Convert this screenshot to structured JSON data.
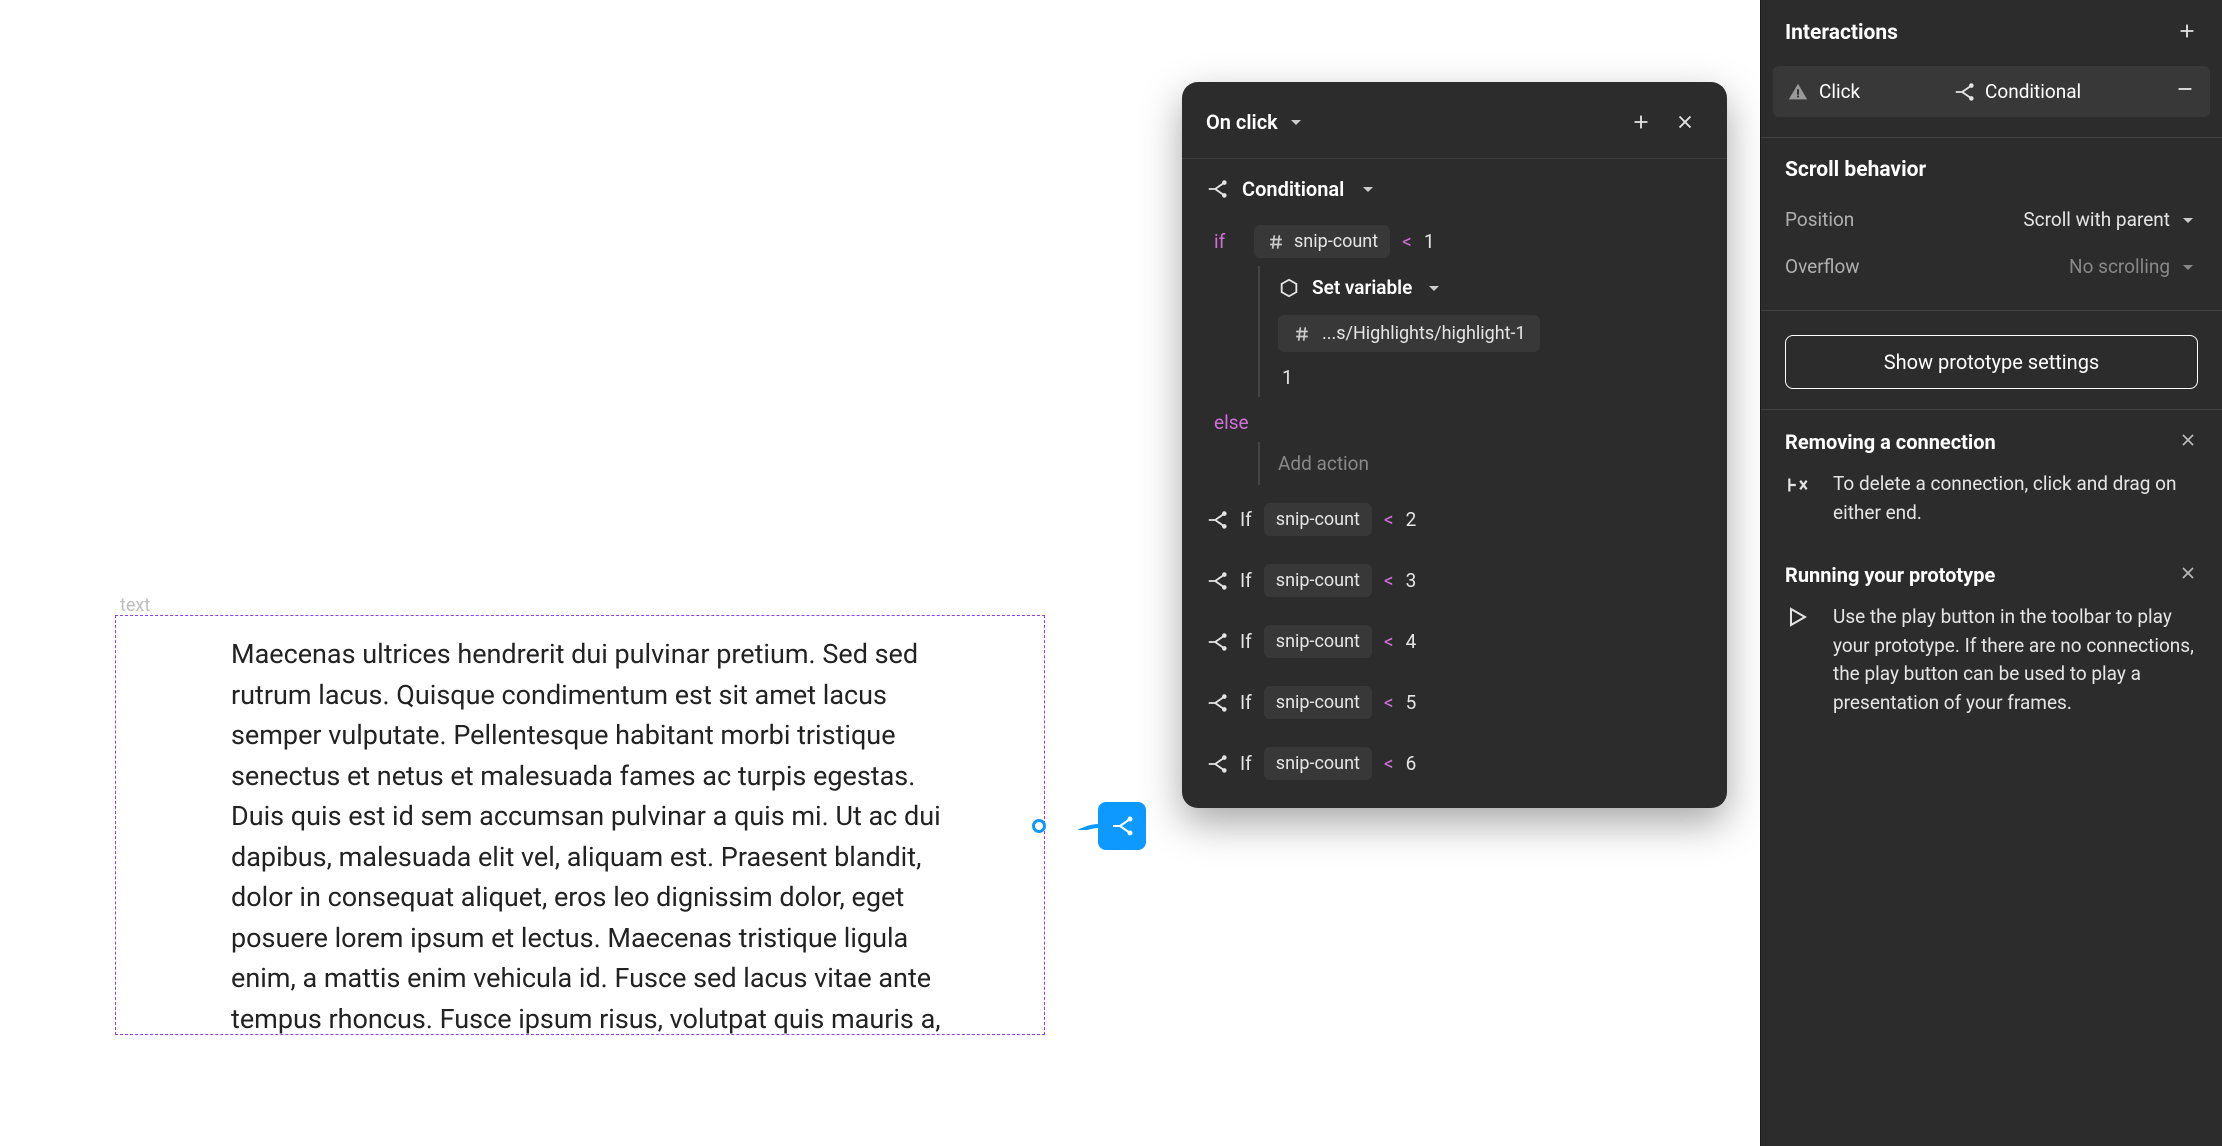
{
  "canvas": {
    "frame_label": "text",
    "body": "Maecenas ultrices hendrerit dui pulvinar pretium. Sed sed rutrum lacus. Quisque condimentum est sit amet lacus semper vulputate. Pellentesque habitant morbi tristique senectus et netus et malesuada fames ac turpis egestas. Duis quis est id sem accumsan pulvinar a quis mi. Ut ac dui dapibus, malesuada elit vel, aliquam est. Praesent blandit, dolor in consequat aliquet, eros leo dignissim dolor, eget posuere lorem ipsum et lectus. Maecenas tristique ligula enim, a mattis enim vehicula id. Fusce sed lacus vitae ante tempus rhoncus. Fusce ipsum risus, volutpat quis mauris a,"
  },
  "onclick": {
    "title": "On click",
    "conditional_label": "Conditional",
    "if_kw": "if",
    "else_kw": "else",
    "if_var": "snip-count",
    "if_op": "<",
    "if_val": "1",
    "set_variable_label": "Set variable",
    "target_var": "...s/Highlights/highlight-1",
    "assign_val": "1",
    "add_action": "Add action",
    "collapsed": [
      {
        "if": "If",
        "var": "snip-count",
        "op": "<",
        "val": "2"
      },
      {
        "if": "If",
        "var": "snip-count",
        "op": "<",
        "val": "3"
      },
      {
        "if": "If",
        "var": "snip-count",
        "op": "<",
        "val": "4"
      },
      {
        "if": "If",
        "var": "snip-count",
        "op": "<",
        "val": "5"
      },
      {
        "if": "If",
        "var": "snip-count",
        "op": "<",
        "val": "6"
      }
    ]
  },
  "sidebar": {
    "interactions_title": "Interactions",
    "row": {
      "trigger": "Click",
      "action": "Conditional"
    },
    "scroll_title": "Scroll behavior",
    "position_label": "Position",
    "position_value": "Scroll with parent",
    "overflow_label": "Overflow",
    "overflow_value": "No scrolling",
    "settings_button": "Show prototype settings",
    "help1": {
      "title": "Removing a connection",
      "text": "To delete a connection, click and drag on either end."
    },
    "help2": {
      "title": "Running your prototype",
      "text": "Use the play button in the toolbar to play your prototype. If there are no connections, the play button can be used to play a presentation of your frames."
    }
  }
}
